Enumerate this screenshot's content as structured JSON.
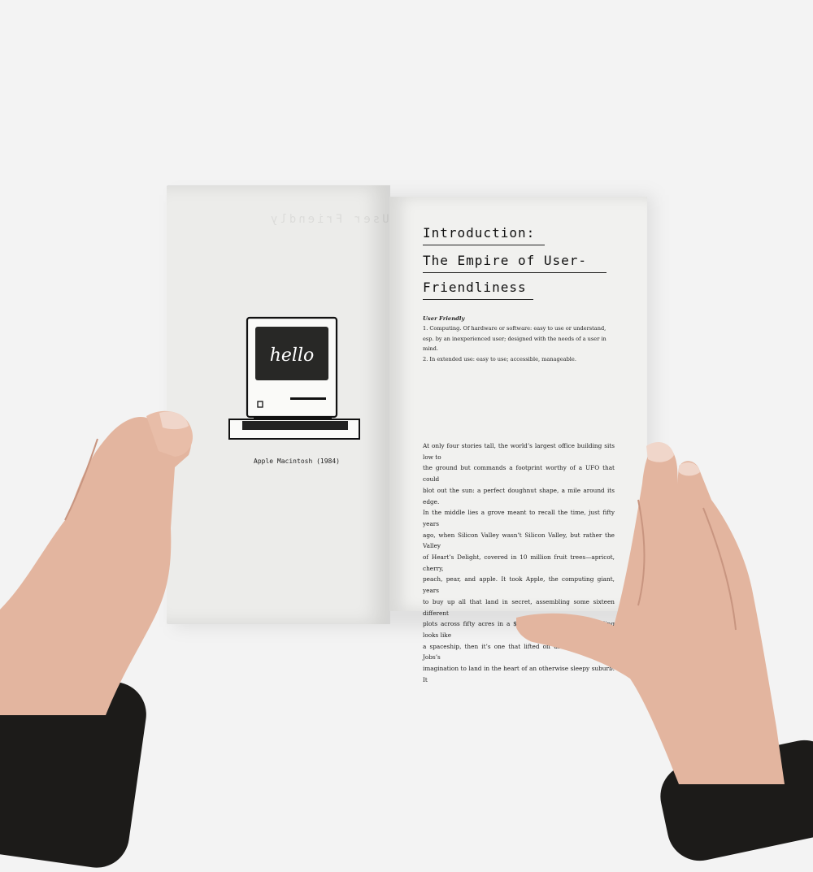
{
  "book": {
    "left_page": {
      "illustration": {
        "icon": "macintosh-computer-icon",
        "screen_text": "hello"
      },
      "caption": "Apple Macintosh (1984)",
      "bleed_through_text": "User Friendly"
    },
    "right_page": {
      "title_lines": [
        "Introduction:",
        "The Empire of User-",
        "Friendliness"
      ],
      "definition": {
        "heading": "User Friendly",
        "lines": [
          "1. Computing. Of hardware or software: easy to use or understand,",
          "esp. by an inexperienced user; designed with the needs of a user in",
          "mind.",
          "2. In extended use: easy to use; accessible, manageable."
        ]
      },
      "body_lines": [
        "At only four stories tall, the world’s largest office building sits low to",
        "the ground but commands a footprint worthy of a UFO that could",
        "blot out the sun: a perfect doughnut shape, a mile around its edge.",
        "In the middle lies a grove meant to recall the time, just fifty years",
        "ago, when Silicon Valley wasn’t Silicon Valley, but rather the Valley",
        "of Heart’s Delight, covered in 10 million fruit trees—apricot, cherry,",
        "peach, pear, and apple. It took Apple, the computing giant, years",
        "to buy up all that land in secret, assembling some sixteen different",
        "plots across fifty acres in a $5 billion jigsaw. If the building looks like",
        "a spaceship, then it’s one that lifted off directly from Steve Jobs’s",
        "imagination to land in the heart of an otherwise sleepy suburb. It"
      ]
    }
  },
  "colors": {
    "background": "#f3f3f3",
    "page": "#f1f1ef",
    "ink": "#111111",
    "skin": "#e3b59f",
    "sleeve": "#1c1b19"
  }
}
